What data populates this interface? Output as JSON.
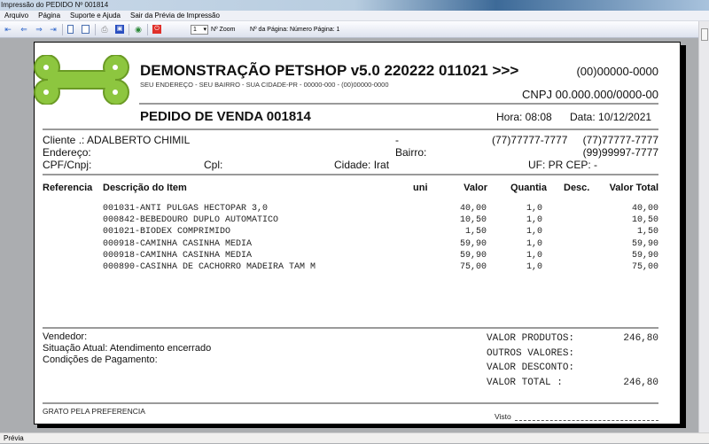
{
  "window": {
    "title": "Impressão do PEDIDO Nº 001814"
  },
  "menu": [
    "Arquivo",
    "Página",
    "Suporte e Ajuda",
    "Sair da Prévia de Impressão"
  ],
  "toolbar": {
    "zoom_value": "1",
    "zoom_label": "Nº Zoom",
    "page_label": "Nº da Página: Número Página: 1"
  },
  "status": "Prévia",
  "company": {
    "name": "DEMONSTRAÇÃO PETSHOP v5.0 220222 011021 >>>",
    "phone": "(00)00000-0000",
    "address": "SEU ENDEREÇO - SEU BAIRRO - SUA CIDADE-PR - 00000-000 - (00)00000-0000",
    "cnpj": "CNPJ 00.000.000/0000-00",
    "logo_color": "#8dc63f"
  },
  "order": {
    "title": "PEDIDO DE VENDA 001814",
    "hora": "Hora: 08:08",
    "data": "Data: 10/12/2021"
  },
  "client": {
    "cliente": "Cliente   .: ADALBERTO CHIMIL",
    "dash": "-",
    "phone1": "(77)77777-7777",
    "phone2": "(77)77777-7777",
    "endereco": "Endereço:",
    "bairro": "Bairro:",
    "phone3": "(99)99997-7777",
    "cpf": "CPF/Cnpj:",
    "cpl": "Cpl:",
    "cidade": "Cidade: Irat",
    "uf": "UF: PR CEP:     -"
  },
  "columns": [
    "Referencia",
    "Descrição do Item",
    "uni",
    "Valor",
    "Quantia",
    "Desc.",
    "Valor Total"
  ],
  "items": [
    {
      "desc": "001031-ANTI PULGAS HECTOPAR 3,0",
      "valor": "40,00",
      "qtd": "1,0",
      "total": "40,00"
    },
    {
      "desc": "000842-BEBEDOURO DUPLO AUTOMATICO",
      "valor": "10,50",
      "qtd": "1,0",
      "total": "10,50"
    },
    {
      "desc": "001021-BIODEX COMPRIMIDO",
      "valor": "1,50",
      "qtd": "1,0",
      "total": "1,50"
    },
    {
      "desc": "000918-CAMINHA CASINHA MEDIA",
      "valor": "59,90",
      "qtd": "1,0",
      "total": "59,90"
    },
    {
      "desc": "000918-CAMINHA CASINHA MEDIA",
      "valor": "59,90",
      "qtd": "1,0",
      "total": "59,90"
    },
    {
      "desc": "000890-CASINHA DE CACHORRO MADEIRA TAM M",
      "valor": "75,00",
      "qtd": "1,0",
      "total": "75,00"
    }
  ],
  "footer": {
    "vendedor": "Vendedor:",
    "situacao": "Situação Atual: Atendimento encerrado",
    "condicoes": "Condições de Pagamento:",
    "grato": "GRATO PELA PREFERENCIA",
    "visto": "Visto"
  },
  "totals": [
    {
      "label": "VALOR PRODUTOS:",
      "value": "246,80"
    },
    {
      "label": "OUTROS VALORES:",
      "value": ""
    },
    {
      "label": "VALOR DESCONTO:",
      "value": ""
    },
    {
      "label": "VALOR TOTAL   :",
      "value": "246,80"
    }
  ]
}
